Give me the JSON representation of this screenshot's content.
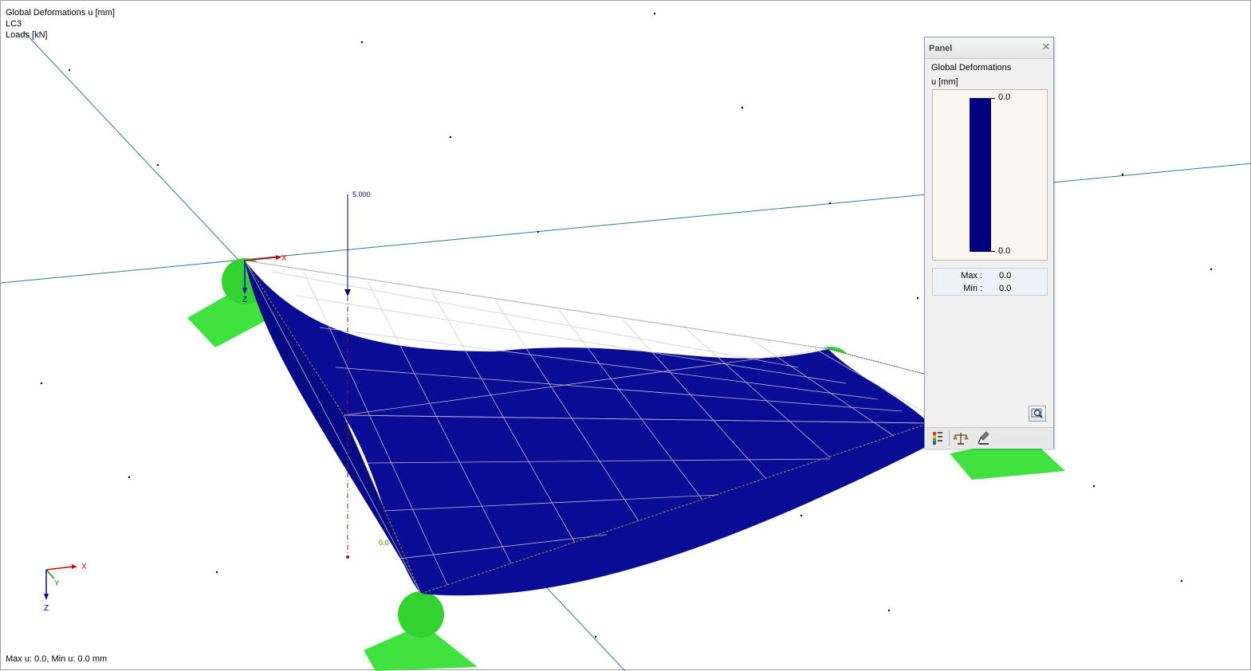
{
  "view": {
    "info_lines": [
      "Global Deformations u [mm]",
      "LC3",
      "Loads [kN]"
    ],
    "status": "Max u: 0.0, Min u: 0.0 mm",
    "load_value": "5.000",
    "axis_label_x": "X",
    "axis_label_y": "Y",
    "axis_label_z": "Z",
    "node_value": "0.0"
  },
  "panel": {
    "title": "Panel",
    "heading": "Global Deformations",
    "unit": "u [mm]",
    "legend": {
      "top_value": "0.0",
      "bottom_value": "0.0",
      "color": "#000080"
    },
    "max_label": "Max",
    "max_value": "0.0",
    "min_label": "Min",
    "min_value": "0.0",
    "footer_tabs": [
      "color-scale-icon",
      "balance-icon",
      "cursor-tool-icon"
    ]
  },
  "colors": {
    "surface": "#0a0c96",
    "support": "#3ae43a",
    "support_sphere": "#2fd12f",
    "load_arrow": "#000080",
    "axis_x": "#cc0000",
    "axis_y": "#00a000",
    "axis_z": "#0000cc",
    "mesh": "#d6d6d6"
  }
}
